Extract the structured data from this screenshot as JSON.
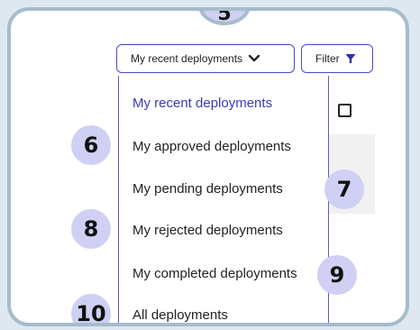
{
  "toolbar": {
    "dropdown_label": "My recent deployments",
    "filter_label": "Filter"
  },
  "menu": {
    "items": [
      {
        "label": "My recent deployments",
        "selected": true
      },
      {
        "label": "My approved deployments",
        "selected": false
      },
      {
        "label": "My pending deployments",
        "selected": false
      },
      {
        "label": "My rejected deployments",
        "selected": false
      },
      {
        "label": "My completed deployments",
        "selected": false
      },
      {
        "label": "All deployments",
        "selected": false
      }
    ]
  },
  "badges": [
    "5",
    "6",
    "7",
    "8",
    "9",
    "10"
  ],
  "colors": {
    "accent": "#4a4ac4",
    "badge_fill": "#cfd0f3",
    "frame_border": "#a6bccc"
  }
}
